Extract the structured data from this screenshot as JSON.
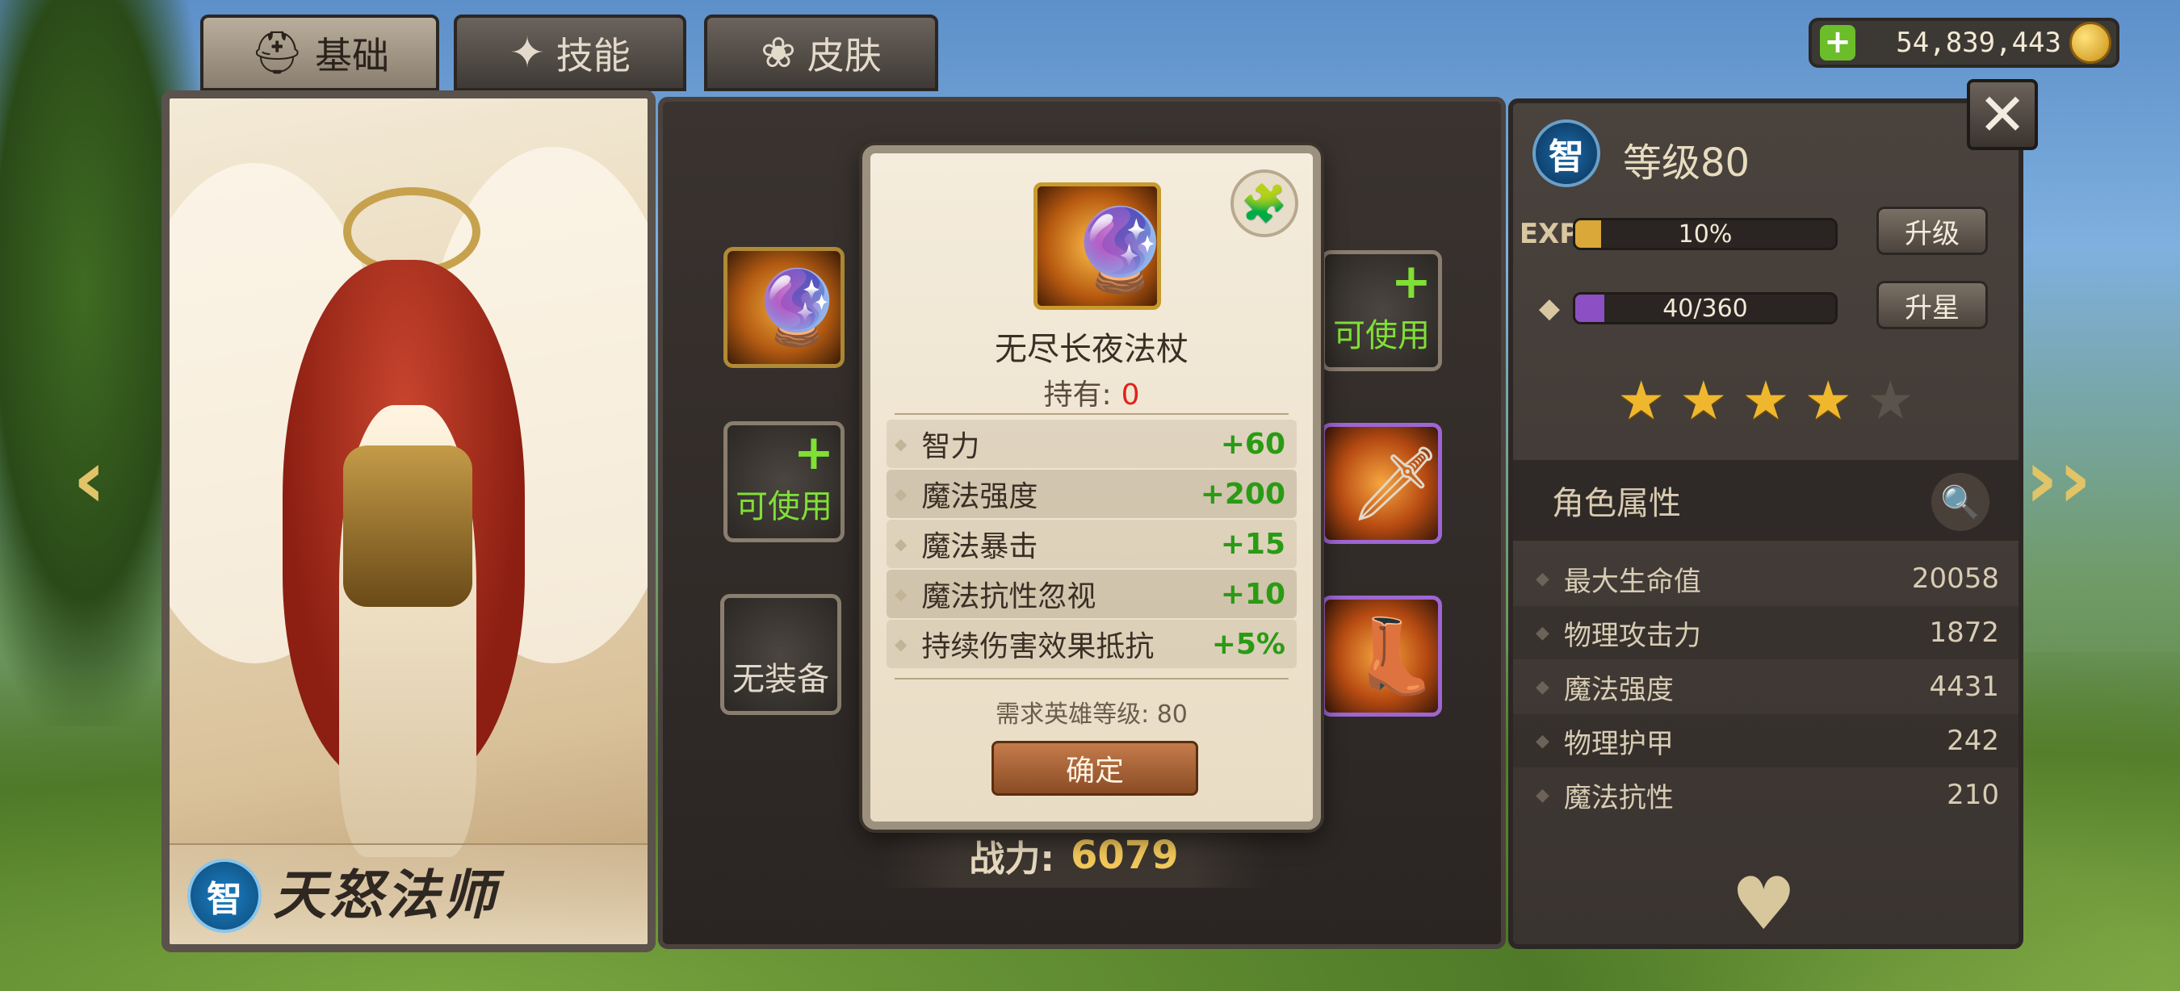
{
  "tabs": [
    {
      "label": "基础",
      "icon": "helmet-icon",
      "active": true
    },
    {
      "label": "技能",
      "icon": "skill-icon",
      "active": false
    },
    {
      "label": "皮肤",
      "icon": "skin-icon",
      "active": false
    }
  ],
  "currency": {
    "gold": "54,839,443",
    "add_icon": "plus-icon",
    "coin_icon": "gold-coin-icon"
  },
  "hero": {
    "class_badge": "智",
    "name": "天怒法师"
  },
  "equipment": {
    "slot_available_label": "可使用",
    "slot_empty_label": "无装备"
  },
  "power": {
    "label": "战力:",
    "value": "6079"
  },
  "stats_panel": {
    "class_badge": "智",
    "level_text": "等级80",
    "exp_label": "EXP",
    "exp_text": "10%",
    "exp_fraction": 0.1,
    "shard_text": "40/360",
    "shard_fraction": 0.111,
    "upgrade_label": "升级",
    "star_up_label": "升星",
    "stars_filled": 4,
    "stars_total": 5,
    "attr_header": "角色属性",
    "attributes": [
      {
        "name": "最大生命值",
        "value": "20058"
      },
      {
        "name": "物理攻击力",
        "value": "1872"
      },
      {
        "name": "魔法强度",
        "value": "4431"
      },
      {
        "name": "物理护甲",
        "value": "242"
      },
      {
        "name": "魔法抗性",
        "value": "210"
      }
    ]
  },
  "popup": {
    "item_name": "无尽长夜法杖",
    "owned_label": "持有:",
    "owned_count": "0",
    "stats": [
      {
        "name": "智力",
        "value": "+60"
      },
      {
        "name": "魔法强度",
        "value": "+200"
      },
      {
        "name": "魔法暴击",
        "value": "+15"
      },
      {
        "name": "魔法抗性忽视",
        "value": "+10"
      },
      {
        "name": "持续伤害效果抵抗",
        "value": "+5%"
      }
    ],
    "requirement": "需求英雄等级: 80",
    "confirm_label": "确定"
  },
  "colors": {
    "accent_green": "#7fe035",
    "stat_green": "#2a9b14",
    "owned_red": "#e0231a",
    "exp_fill": "#d9a838",
    "shard_fill": "#8c4fc4"
  }
}
